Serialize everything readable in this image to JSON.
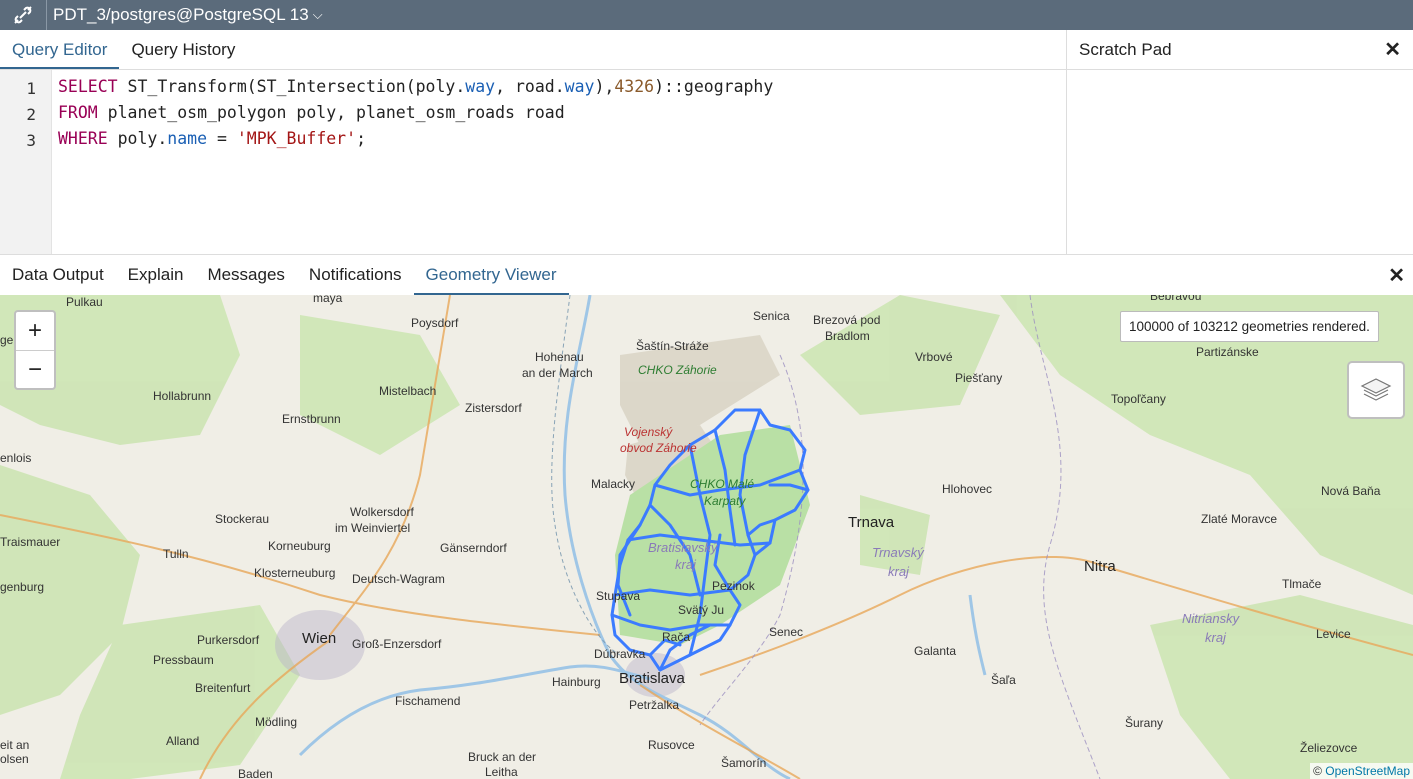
{
  "topbar": {
    "connection_title": "PDT_3/postgres@PostgreSQL 13"
  },
  "editor": {
    "tabs": [
      "Query Editor",
      "Query History"
    ],
    "line_numbers": [
      "1",
      "2",
      "3"
    ],
    "line1": {
      "kw": "SELECT",
      "a": " ST_Transform(ST_Intersection(poly.",
      "b": "way",
      "c": ", road.",
      "d": "way",
      "e": "),",
      "f": "4326",
      "g": ")::geography"
    },
    "line2": {
      "kw": "FROM",
      "a": " planet_osm_polygon poly, planet_osm_roads road"
    },
    "line3": {
      "kw": "WHERE",
      "a": " poly.",
      "b": "name",
      "c": " = ",
      "d": "'MPK_Buffer'",
      "e": ";"
    }
  },
  "scratch_pad": {
    "title": "Scratch Pad",
    "close": "✕"
  },
  "results": {
    "tabs": [
      "Data Output",
      "Explain",
      "Messages",
      "Notifications",
      "Geometry Viewer"
    ],
    "close": "✕"
  },
  "map": {
    "zoom_in": "+",
    "zoom_out": "−",
    "info": "100000 of 103212 geometries rendered.",
    "attribution_prefix": "© ",
    "attribution_link": "OpenStreetMap",
    "labels": {
      "pulkau": "Pulkau",
      "mraya": "maya",
      "poysdorf": "Poysdorf",
      "senica": "Senica",
      "brezova": "Brezová pod",
      "bradlom": "Bradlom",
      "bebravou": "Bebravou",
      "genburg": "genburg",
      "sastin": "Šaštín-Stráže",
      "hohenau": "Hohenau",
      "andermarch": "an der March",
      "vrbove": "Vrbové",
      "partizanske": "Partizánske",
      "chko_zahorie": "CHKO Záhorie",
      "piestany": "Piešťany",
      "hollabrunn": "Hollabrunn",
      "mistelbach": "Mistelbach",
      "zistersdorf": "Zistersdorf",
      "topolcany": "Topoľčany",
      "ernstbrunn": "Ernstbrunn",
      "vojensky": "Vojenský",
      "obvod": "obvod Záhorie",
      "enlois": "enlois",
      "malacky": "Malacky",
      "chko_male": "CHKO Malé",
      "karpaty": "Karpaty",
      "hlohovec": "Hlohovec",
      "novabana": "Nová Baňa",
      "wolkersdorf": "Wolkersdorf",
      "weinviertel": "im Weinviertel",
      "stockerau": "Stockerau",
      "trnava": "Trnava",
      "zlate": "Zlaté Moravce",
      "traismauer": "Traismauer",
      "bratislavsky": "Bratislavský",
      "kraj": "kraj",
      "tulln": "Tulln",
      "korneuburg": "Korneuburg",
      "ganserndorf": "Gänserndorf",
      "trnavsky": "Trnavský",
      "trnavakraj": "kraj",
      "nitra": "Nitra",
      "genburg2": "genburg",
      "klosterneuburg": "Klosterneuburg",
      "deutsch": "Deutsch-Wagram",
      "tlmace": "Tlmače",
      "stupava": "Stupava",
      "svaty": "Svätý Ju",
      "pezinok": "Pezinok",
      "nitriansky": "Nitriansky",
      "nitrakraj": "kraj",
      "purkersdorf": "Purkersdorf",
      "wien": "Wien",
      "gross": "Groß-Enzersdorf",
      "senec": "Senec",
      "levice": "Levice",
      "pressbaum": "Pressbaum",
      "raca": "Rača",
      "galanta": "Galanta",
      "dubravka": "Dúbravka",
      "breitenfurt": "Breitenfurt",
      "hainburg": "Hainburg",
      "bratislava": "Bratislava",
      "sala": "Šaľa",
      "fischamend": "Fischamend",
      "petrzalka": "Petržalka",
      "modling": "Mödling",
      "surany": "Šurany",
      "allandl": "Alland",
      "rusovce": "Rusovce",
      "zeliezovce": "Želiezovce",
      "eitan": "eit an",
      "bruck": "Bruck an der",
      "leitha": "Leitha",
      "olsen": "olsen",
      "baden": "Baden",
      "samorin": "Šamorín"
    }
  }
}
